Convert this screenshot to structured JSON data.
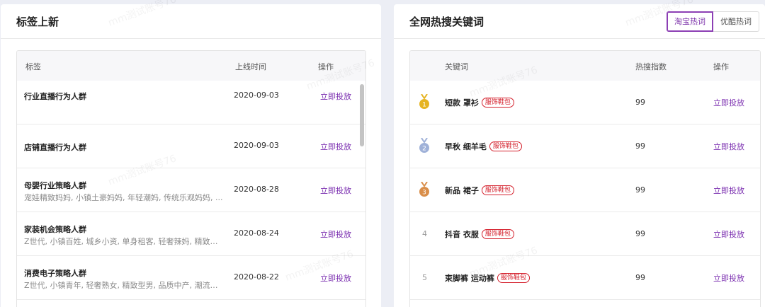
{
  "tag_panel": {
    "title": "标签上新",
    "columns": {
      "tag": "标签",
      "online_time": "上线时间",
      "action": "操作"
    },
    "rows": [
      {
        "name": "行业直播行为人群",
        "desc": "",
        "date": "2020-09-03",
        "action": "立即投放"
      },
      {
        "name": "店铺直播行为人群",
        "desc": "",
        "date": "2020-09-03",
        "action": "立即投放"
      },
      {
        "name": "母婴行业策略人群",
        "desc": "宠娃精致妈妈, 小镇土豪妈妈, 年轻潮妈, 传统乐观妈妈, ...",
        "date": "2020-08-28",
        "action": "立即投放"
      },
      {
        "name": "家装机会策略人群",
        "desc": "Z世代, 小镇百姓, 城乡小资, 单身租客, 轻奢辣妈, 精致型...",
        "date": "2020-08-24",
        "action": "立即投放"
      },
      {
        "name": "消费电子策略人群",
        "desc": "Z世代, 小镇青年, 轻奢熟女, 精致型男, 品质中产, 潮流租...",
        "date": "2020-08-22",
        "action": "立即投放"
      }
    ]
  },
  "keyword_panel": {
    "title": "全网热搜关键词",
    "tabs": [
      {
        "label": "淘宝热词",
        "active": true
      },
      {
        "label": "优酷热词",
        "active": false
      }
    ],
    "columns": {
      "keyword": "关键词",
      "score": "热搜指数",
      "action": "操作"
    },
    "rows": [
      {
        "rank": "1",
        "medal": "gold-medal-icon",
        "keyword": "短款 罩衫",
        "tag": "服饰鞋包",
        "score": "99",
        "action": "立即投放"
      },
      {
        "rank": "2",
        "medal": "silver-medal-icon",
        "keyword": "早秋 细羊毛",
        "tag": "服饰鞋包",
        "score": "99",
        "action": "立即投放"
      },
      {
        "rank": "3",
        "medal": "bronze-medal-icon",
        "keyword": "新品 裙子",
        "tag": "服饰鞋包",
        "score": "99",
        "action": "立即投放"
      },
      {
        "rank": "4",
        "medal": "",
        "keyword": "抖音 衣服",
        "tag": "服饰鞋包",
        "score": "99",
        "action": "立即投放"
      },
      {
        "rank": "5",
        "medal": "",
        "keyword": "束脚裤 运动裤",
        "tag": "服饰鞋包",
        "score": "99",
        "action": "立即投放"
      }
    ]
  },
  "watermark": "mm测试账号76",
  "colors": {
    "accent": "#7b2fb0",
    "tag_red": "#d4202c",
    "gold": "#e6b422",
    "silver": "#9fb1d8",
    "bronze": "#d98e4a"
  }
}
